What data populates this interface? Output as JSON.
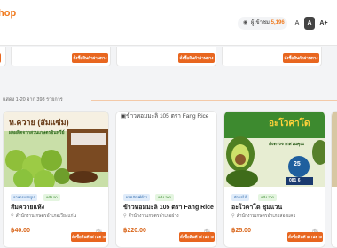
{
  "header": {
    "logo_text": "hop",
    "logo_sub": "i",
    "visits_label": "ผู้เข้าชม",
    "visits_count": "5,196",
    "font_small": "A",
    "font_mid": "A",
    "font_large": "A+"
  },
  "top_row": {
    "order_label": "สั่งซื้อสินค้าผ่านทาง"
  },
  "results": {
    "text": "แสดง 1-20 จาก 398 รายการ"
  },
  "products": [
    {
      "image_text_1": "ห.ควาย (สัมแซ่ม)",
      "image_text_2": "ผลผลิตจากสวนเกษตรอินทรีย์",
      "category": "อาหารแปรรูป",
      "stock": "คลัง 50",
      "name": "ส้มควายแห้ง",
      "location": "สำนักงานเกษตรอำเภอเวียงแก่น",
      "price": "฿40.00",
      "unit": "/ชิ้น",
      "order_label": "สั่งซื้อสินค้าผ่านทาง"
    },
    {
      "image_alt": "ข้าวหอมมะลิ 105 ตรา Fang Rice",
      "category": "ผลิตภัณฑ์ข้าว",
      "stock": "คลัง 200",
      "name": "ข้าวหอมมะลิ 105 ตรา Fang Rice",
      "location": "สำนักงานเกษตรอำเภอฝาง",
      "price": "฿220.00",
      "unit": "/ชิ้น",
      "order_label": "สั่งซื้อสินค้าผ่านทาง"
    },
    {
      "image_text_1": "อะโวคาโด",
      "image_text_2": "ส่งตรงจากสวนคุณ",
      "image_price": "25",
      "image_phone": "081 6",
      "category": "ผักผลไม้",
      "stock": "คลัง 200",
      "name": "อะโวคาโด ชุมแวน",
      "location": "สำนักงานเกษตรอำเภอสองแคว",
      "price": "฿25.00",
      "unit": "/ชิ้น",
      "order_label": "สั่งซื้อสินค้าผ่านทาง"
    }
  ],
  "colors": {
    "accent": "#e8661f",
    "price": "#d9661b",
    "badge_category_bg": "#e0ecfa",
    "badge_stock_bg": "#e4f5e0"
  }
}
